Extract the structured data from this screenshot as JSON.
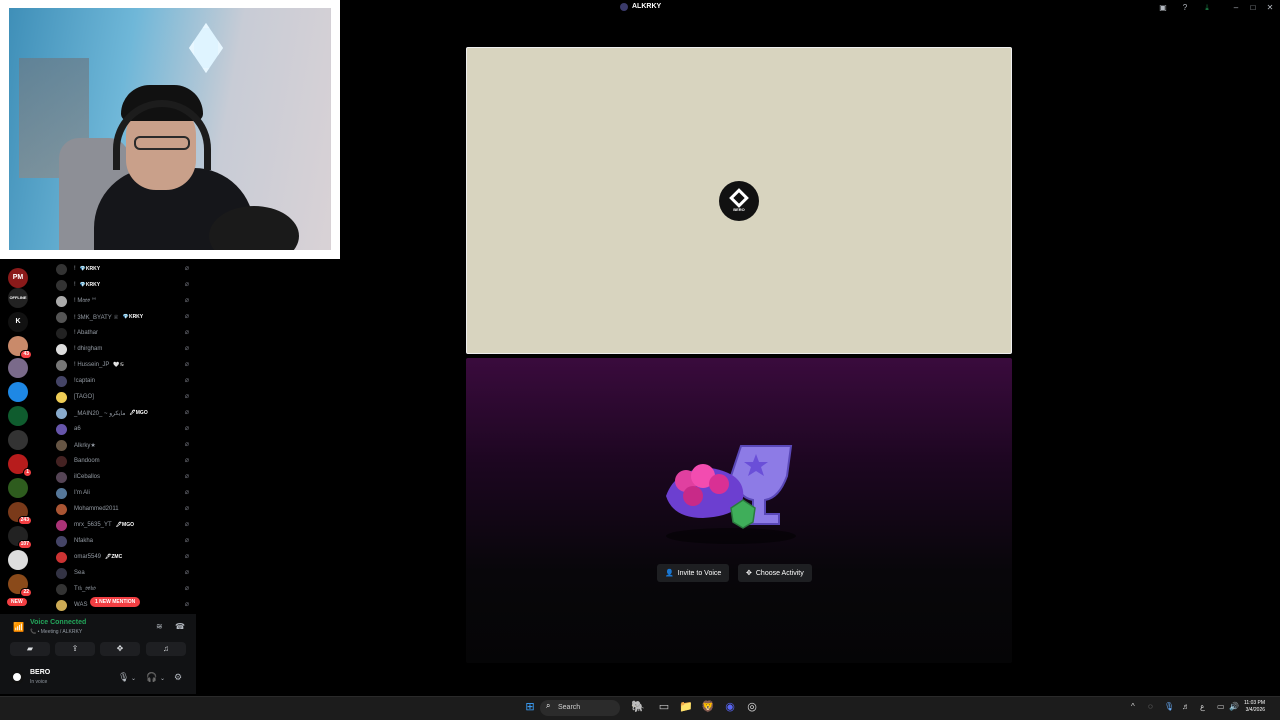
{
  "window": {
    "title": "ALKRKY"
  },
  "server_rail": {
    "servers": [
      {
        "name": "server-pm",
        "label": "PM",
        "color": "#8b1a1a"
      },
      {
        "name": "server-offline",
        "label": "OFFLINE",
        "color": "#222"
      },
      {
        "name": "server-k",
        "label": "K",
        "color": "#111"
      },
      {
        "name": "server-avatar-1",
        "label": "",
        "color": "#c98a6a",
        "badge": "43"
      },
      {
        "name": "server-avatar-2",
        "label": "",
        "color": "#7a6a8a"
      },
      {
        "name": "server-blue",
        "label": "",
        "color": "#1e88e5"
      },
      {
        "name": "server-green",
        "label": "",
        "color": "#0f5c2e"
      },
      {
        "name": "server-mix",
        "label": "",
        "color": "#333"
      },
      {
        "name": "server-red",
        "label": "",
        "color": "#b71c1c",
        "badge": "1"
      },
      {
        "name": "server-leaf",
        "label": "",
        "color": "#2e5c1e"
      },
      {
        "name": "server-fire",
        "label": "",
        "color": "#7a3a1a",
        "badge": "243"
      },
      {
        "name": "server-dark",
        "label": "",
        "color": "#222",
        "badge": "107"
      },
      {
        "name": "server-white",
        "label": "",
        "color": "#ddd"
      },
      {
        "name": "server-brown",
        "label": "",
        "color": "#8a4a1a",
        "badge": "22"
      }
    ],
    "new_label": "NEW"
  },
  "members": [
    {
      "name": "!",
      "tag": "💎KRKY"
    },
    {
      "name": "!",
      "tag": "💎KRKY"
    },
    {
      "name": "! M𝔞𝔬𝔬 °°",
      "tag": ""
    },
    {
      "name": "! 3MK_BYATY ♕",
      "tag": "💎KRKY"
    },
    {
      "name": "! Abathar",
      "tag": ""
    },
    {
      "name": "! dhirgham",
      "tag": ""
    },
    {
      "name": "! Hussein_JP",
      "tag": "🤍♋"
    },
    {
      "name": "!captain",
      "tag": ""
    },
    {
      "name": "[TAGO]",
      "tag": ""
    },
    {
      "name": "_MAIN20_ ~ مايكرو",
      "tag": "🖊MGO"
    },
    {
      "name": "a6",
      "tag": ""
    },
    {
      "name": "Alkrky★",
      "tag": ""
    },
    {
      "name": "Bandoom",
      "tag": ""
    },
    {
      "name": "ilCeballos",
      "tag": ""
    },
    {
      "name": "I'm Ali",
      "tag": ""
    },
    {
      "name": "Mohammed2011",
      "tag": ""
    },
    {
      "name": "mrx_5635_YT",
      "tag": "🖊MGO"
    },
    {
      "name": "Nfakha",
      "tag": ""
    },
    {
      "name": "omar5549",
      "tag": "🖊ZMC"
    },
    {
      "name": "Sea",
      "tag": ""
    },
    {
      "name": "T𝔦𝔨_𝔬𝔬𝔨𝔬",
      "tag": ""
    },
    {
      "name": "WAS",
      "tag": ""
    }
  ],
  "mention_pill": "1 NEW MENTION",
  "voice": {
    "status": "Voice Connected",
    "channel": "📞 • Meeting / ALKRKY"
  },
  "user": {
    "name": "BERO",
    "status": "In voice"
  },
  "stage": {
    "avatar_name": "BERO"
  },
  "activity": {
    "invite_label": "Invite to Voice",
    "choose_label": "Choose Activity"
  },
  "taskbar": {
    "search_placeholder": "Search",
    "time": "11:03 PM",
    "date": "3/4/2026"
  },
  "colors": {
    "voice_green": "#23a55a",
    "alert_red": "#f23f43",
    "stage_bg": "#d8d4bf"
  }
}
